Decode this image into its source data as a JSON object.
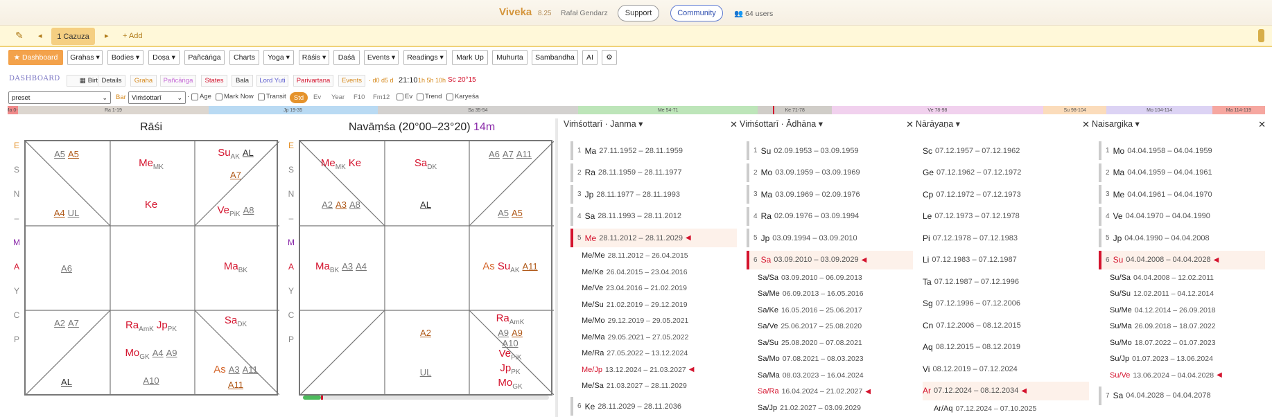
{
  "titlebar": {
    "app_name": "Viveka",
    "version": "8.25",
    "author": "Rafał Gendarz",
    "support_label": "Support",
    "community_label": "Community",
    "users": "👥 64 users"
  },
  "casebar": {
    "edit_icon": "✎",
    "prev": "◂",
    "tab_label": "1 Cazuza",
    "next": "▸",
    "add_label": "+ Add"
  },
  "toolbar": {
    "dashboard_label": "★ Dashboard",
    "buttons": [
      "Grahas ▾",
      "Bodies ▾",
      "Doṣa ▾",
      "Pañcāṅga",
      "Charts",
      "Yoga ▾",
      "Rāśis ▾",
      "Daśā",
      "Events ▾",
      "Readings ▾",
      "Mark Up",
      "Muhurta",
      "Sambandha",
      "AI",
      "⚙"
    ]
  },
  "tabrow": {
    "dashboard": "DASHBOARD",
    "tabs": [
      "Birth",
      "Details",
      "Graha",
      "Pañcāṅga",
      "States",
      "Bala",
      "Lord Yuti",
      "Parivartana",
      "Events"
    ],
    "tab_colors": [
      "#555",
      "#333",
      "#d6891c",
      "#c56ad6",
      "#d4142e",
      "#555",
      "#5c5ccf",
      "#d4142e",
      "#d6891c"
    ],
    "extra1": "· d0 d5 d",
    "time": "21:10",
    "extra2": "1h 5h 10h",
    "sc": "Sc 20°15"
  },
  "controls": {
    "preset": "preset",
    "bar_label": "Bar",
    "dasha_system": "Viṁśottarī",
    "age": "Age",
    "mark_now": "Mark Now",
    "transit": "Transit",
    "std": "Std",
    "ev": "Ev",
    "year": "Year",
    "f10": "F10",
    "fm12": "Fm12",
    "ev2": "Ev",
    "trend": "Trend",
    "karyesa": "Karyeśa"
  },
  "timeline": {
    "segments": [
      {
        "label": "Ma 0-1",
        "color": "#f08a8a",
        "start": 0,
        "end": 1
      },
      {
        "label": "Ra 1-19",
        "color": "#dcd6cf",
        "start": 1,
        "end": 19
      },
      {
        "label": "Jp 19-35",
        "color": "#b9daf3",
        "start": 19,
        "end": 35
      },
      {
        "label": "Sa 35-54",
        "color": "#d3d1cf",
        "start": 35,
        "end": 54
      },
      {
        "label": "Me 54-71",
        "color": "#bde5b9",
        "start": 54,
        "end": 71
      },
      {
        "label": "Ke 71-78",
        "color": "#d0cdc8",
        "start": 71,
        "end": 78
      },
      {
        "label": "Ve 78-98",
        "color": "#f1d1ee",
        "start": 78,
        "end": 98
      },
      {
        "label": "Su 98-104",
        "color": "#fbdcbb",
        "start": 98,
        "end": 104
      },
      {
        "label": "Mo 104-114",
        "color": "#dcd3f4",
        "start": 104,
        "end": 114
      },
      {
        "label": "Ma 114-119",
        "color": "#f6a7a0",
        "start": 114,
        "end": 119
      }
    ],
    "current_age": 72.4,
    "total": 119
  },
  "rasi": {
    "title": "Rāśi",
    "axis": [
      "E",
      "S",
      "N",
      "–",
      "M",
      "A",
      "Y",
      "C",
      "P"
    ],
    "cells": {
      "c1": [
        [
          {
            "t": "A5",
            "c": "ar"
          },
          {
            "t": "A5",
            "c": "ar o"
          }
        ],
        [],
        [],
        [
          {
            "t": "A4",
            "c": "ar o"
          },
          {
            "t": "UL",
            "c": "ar"
          }
        ]
      ],
      "c2": [
        [
          {
            "t": "Me",
            "c": "pl",
            "s": "MK"
          }
        ],
        [
          {
            "t": "Ke",
            "c": "pl"
          }
        ]
      ],
      "c3": [
        [
          {
            "t": "Su",
            "c": "pl",
            "s": "AK"
          },
          {
            "t": "AL",
            "c": "ar k"
          }
        ],
        [
          {
            "t": "A7",
            "c": "ar o"
          }
        ],
        [],
        [
          {
            "t": "Ve",
            "c": "pl",
            "s": "PiK"
          },
          {
            "t": "A8",
            "c": "ar"
          }
        ]
      ],
      "c4": [
        [
          {
            "t": "A6",
            "c": "ar"
          }
        ]
      ],
      "c5": [],
      "c6": [
        [
          {
            "t": "Ma",
            "c": "pl",
            "s": "BK"
          }
        ]
      ],
      "c7": [
        [
          {
            "t": "A2",
            "c": "ar"
          },
          {
            "t": "A7",
            "c": "ar"
          }
        ],
        [],
        [],
        [
          {
            "t": "AL",
            "c": "ar k"
          }
        ]
      ],
      "c8": [
        [
          {
            "t": "Ra",
            "c": "pl",
            "s": "AmK"
          },
          {
            "t": "Jp",
            "c": "pl",
            "s": "PK"
          }
        ],
        [
          {
            "t": "Mo",
            "c": "pl",
            "s": "GK"
          },
          {
            "t": "A4",
            "c": "ar"
          },
          {
            "t": "A9",
            "c": "ar"
          }
        ],
        [
          {
            "t": "A10",
            "c": "ar"
          }
        ]
      ],
      "c9": [
        [
          {
            "t": "Sa",
            "c": "pl",
            "s": "DK"
          }
        ],
        [],
        [],
        [
          {
            "t": "As",
            "c": "pl o"
          },
          {
            "t": "A3",
            "c": "ar"
          },
          {
            "t": "A11",
            "c": "ar"
          }
        ],
        [
          {
            "t": "A11",
            "c": "ar o"
          }
        ]
      ]
    }
  },
  "navamsa": {
    "title": "Navāṃśa (20°00–23°20)",
    "duration": "14m",
    "axis": [
      "E",
      "S",
      "N",
      "–",
      "M",
      "A",
      "Y",
      "C",
      "P"
    ],
    "cells": {
      "c1": [
        [
          {
            "t": "Me",
            "c": "pl",
            "s": "MK"
          },
          {
            "t": "Ke",
            "c": "pl"
          }
        ],
        [
          {
            "t": "A2",
            "c": "ar"
          },
          {
            "t": "A3",
            "c": "ar o"
          },
          {
            "t": "A8",
            "c": "ar"
          }
        ]
      ],
      "c2": [
        [
          {
            "t": "Sa",
            "c": "pl",
            "s": "DK"
          }
        ],
        [
          {
            "t": "AL",
            "c": "ar k"
          }
        ]
      ],
      "c3": [
        [
          {
            "t": "A6",
            "c": "ar"
          },
          {
            "t": "A7",
            "c": "ar"
          },
          {
            "t": "A11",
            "c": "ar"
          }
        ],
        [],
        [],
        [
          {
            "t": "A5",
            "c": "ar"
          },
          {
            "t": "A5",
            "c": "ar o"
          }
        ]
      ],
      "c4": [
        [
          {
            "t": "Ma",
            "c": "pl",
            "s": "BK"
          },
          {
            "t": "A3",
            "c": "ar"
          },
          {
            "t": "A4",
            "c": "ar"
          }
        ]
      ],
      "c5": [],
      "c6": [
        [
          {
            "t": "As",
            "c": "pl o"
          },
          {
            "t": "Su",
            "c": "pl",
            "s": "AK"
          },
          {
            "t": "A11",
            "c": "ar o"
          }
        ]
      ],
      "c7": [],
      "c8": [
        [
          {
            "t": "A2",
            "c": "ar o"
          }
        ],
        [
          {
            "t": "UL",
            "c": "ar"
          }
        ]
      ],
      "c9": [
        [
          {
            "t": "Ra",
            "c": "pl",
            "s": "AmK"
          }
        ],
        [
          {
            "t": "A9",
            "c": "ar"
          },
          {
            "t": "A9",
            "c": "ar o"
          }
        ],
        [
          {
            "t": "A10",
            "c": "ar"
          }
        ],
        [
          {
            "t": "Ve",
            "c": "pl",
            "s": "PiK"
          }
        ],
        [
          {
            "t": "Jp",
            "c": "pl",
            "s": "PK"
          }
        ],
        [
          {
            "t": "Mo",
            "c": "pl",
            "s": "GK"
          }
        ]
      ]
    }
  },
  "dasha": [
    {
      "title": "Viṁśottarī · Janma ▾",
      "rows": [
        {
          "n": "1",
          "lord": "Ma",
          "dates": "27.11.1952 – 28.11.1959"
        },
        {
          "n": "2",
          "lord": "Ra",
          "dates": "28.11.1959 – 28.11.1977"
        },
        {
          "n": "3",
          "lord": "Jp",
          "dates": "28.11.1977 – 28.11.1993"
        },
        {
          "n": "4",
          "lord": "Sa",
          "dates": "28.11.1993 – 28.11.2012"
        },
        {
          "n": "5",
          "lord": "Me",
          "dates": "28.11.2012 – 28.11.2029",
          "cur": true
        }
      ],
      "subs": [
        {
          "lord": "Me/Me",
          "dates": "28.11.2012 – 26.04.2015"
        },
        {
          "lord": "Me/Ke",
          "dates": "26.04.2015 – 23.04.2016"
        },
        {
          "lord": "Me/Ve",
          "dates": "23.04.2016 – 21.02.2019"
        },
        {
          "lord": "Me/Su",
          "dates": "21.02.2019 – 29.12.2019"
        },
        {
          "lord": "Me/Mo",
          "dates": "29.12.2019 – 29.05.2021"
        },
        {
          "lord": "Me/Ma",
          "dates": "29.05.2021 – 27.05.2022"
        },
        {
          "lord": "Me/Ra",
          "dates": "27.05.2022 – 13.12.2024"
        },
        {
          "lord": "Me/Jp",
          "dates": "13.12.2024 – 21.03.2027",
          "cur": true
        },
        {
          "lord": "Me/Sa",
          "dates": "21.03.2027 – 28.11.2029"
        }
      ],
      "after": [
        {
          "n": "6",
          "lord": "Ke",
          "dates": "28.11.2029 – 28.11.2036"
        }
      ]
    },
    {
      "title": "Viṁśottarī · Ādhāna ▾",
      "rows": [
        {
          "n": "1",
          "lord": "Su",
          "dates": "02.09.1953 – 03.09.1959"
        },
        {
          "n": "2",
          "lord": "Mo",
          "dates": "03.09.1959 – 03.09.1969"
        },
        {
          "n": "3",
          "lord": "Ma",
          "dates": "03.09.1969 – 02.09.1976"
        },
        {
          "n": "4",
          "lord": "Ra",
          "dates": "02.09.1976 – 03.09.1994"
        },
        {
          "n": "5",
          "lord": "Jp",
          "dates": "03.09.1994 – 03.09.2010"
        },
        {
          "n": "6",
          "lord": "Sa",
          "dates": "03.09.2010 – 03.09.2029",
          "cur": true
        }
      ],
      "subs": [
        {
          "lord": "Sa/Sa",
          "dates": "03.09.2010 – 06.09.2013"
        },
        {
          "lord": "Sa/Me",
          "dates": "06.09.2013 – 16.05.2016"
        },
        {
          "lord": "Sa/Ke",
          "dates": "16.05.2016 – 25.06.2017"
        },
        {
          "lord": "Sa/Ve",
          "dates": "25.06.2017 – 25.08.2020"
        },
        {
          "lord": "Sa/Su",
          "dates": "25.08.2020 – 07.08.2021"
        },
        {
          "lord": "Sa/Mo",
          "dates": "07.08.2021 – 08.03.2023"
        },
        {
          "lord": "Sa/Ma",
          "dates": "08.03.2023 – 16.04.2024"
        },
        {
          "lord": "Sa/Ra",
          "dates": "16.04.2024 – 21.02.2027",
          "cur": true
        },
        {
          "lord": "Sa/Jp",
          "dates": "21.02.2027 – 03.09.2029"
        }
      ],
      "after": []
    },
    {
      "title": "Nārāyaṇa ▾",
      "plain": true,
      "rows": [
        {
          "lord": "Sc",
          "dates": "07.12.1957 – 07.12.1962"
        },
        {
          "lord": "Ge",
          "dates": "07.12.1962 – 07.12.1972"
        },
        {
          "lord": "Cp",
          "dates": "07.12.1972 – 07.12.1973"
        },
        {
          "lord": "Le",
          "dates": "07.12.1973 – 07.12.1978"
        },
        {
          "lord": "Pi",
          "dates": "07.12.1978 – 07.12.1983"
        },
        {
          "lord": "Li",
          "dates": "07.12.1983 – 07.12.1987"
        },
        {
          "lord": "Ta",
          "dates": "07.12.1987 – 07.12.1996"
        },
        {
          "lord": "Sg",
          "dates": "07.12.1996 – 07.12.2006"
        },
        {
          "lord": "Cn",
          "dates": "07.12.2006 – 08.12.2015"
        },
        {
          "lord": "Aq",
          "dates": "08.12.2015 – 08.12.2019"
        },
        {
          "lord": "Vi",
          "dates": "08.12.2019 – 07.12.2024"
        },
        {
          "lord": "Ar",
          "dates": "07.12.2024 – 08.12.2034",
          "cur": true
        }
      ],
      "subs": [
        {
          "lord": "Ar/Aq",
          "dates": "07.12.2024 – 07.10.2025"
        }
      ],
      "after": []
    },
    {
      "title": "Naisargika ▾",
      "rows": [
        {
          "n": "1",
          "lord": "Mo",
          "dates": "04.04.1958 – 04.04.1959"
        },
        {
          "n": "2",
          "lord": "Ma",
          "dates": "04.04.1959 – 04.04.1961"
        },
        {
          "n": "3",
          "lord": "Me",
          "dates": "04.04.1961 – 04.04.1970"
        },
        {
          "n": "4",
          "lord": "Ve",
          "dates": "04.04.1970 – 04.04.1990"
        },
        {
          "n": "5",
          "lord": "Jp",
          "dates": "04.04.1990 – 04.04.2008"
        },
        {
          "n": "6",
          "lord": "Su",
          "dates": "04.04.2008 – 04.04.2028",
          "cur": true
        }
      ],
      "subs": [
        {
          "lord": "Su/Sa",
          "dates": "04.04.2008 – 12.02.2011"
        },
        {
          "lord": "Su/Su",
          "dates": "12.02.2011 – 04.12.2014"
        },
        {
          "lord": "Su/Me",
          "dates": "04.12.2014 – 26.09.2018"
        },
        {
          "lord": "Su/Ma",
          "dates": "26.09.2018 – 18.07.2022"
        },
        {
          "lord": "Su/Mo",
          "dates": "18.07.2022 – 01.07.2023"
        },
        {
          "lord": "Su/Jp",
          "dates": "01.07.2023 – 13.06.2024"
        },
        {
          "lord": "Su/Ve",
          "dates": "13.06.2024 – 04.04.2028",
          "cur": true
        }
      ],
      "after": [
        {
          "n": "7",
          "lord": "Sa",
          "dates": "04.04.2028 – 04.04.2078"
        }
      ]
    }
  ]
}
